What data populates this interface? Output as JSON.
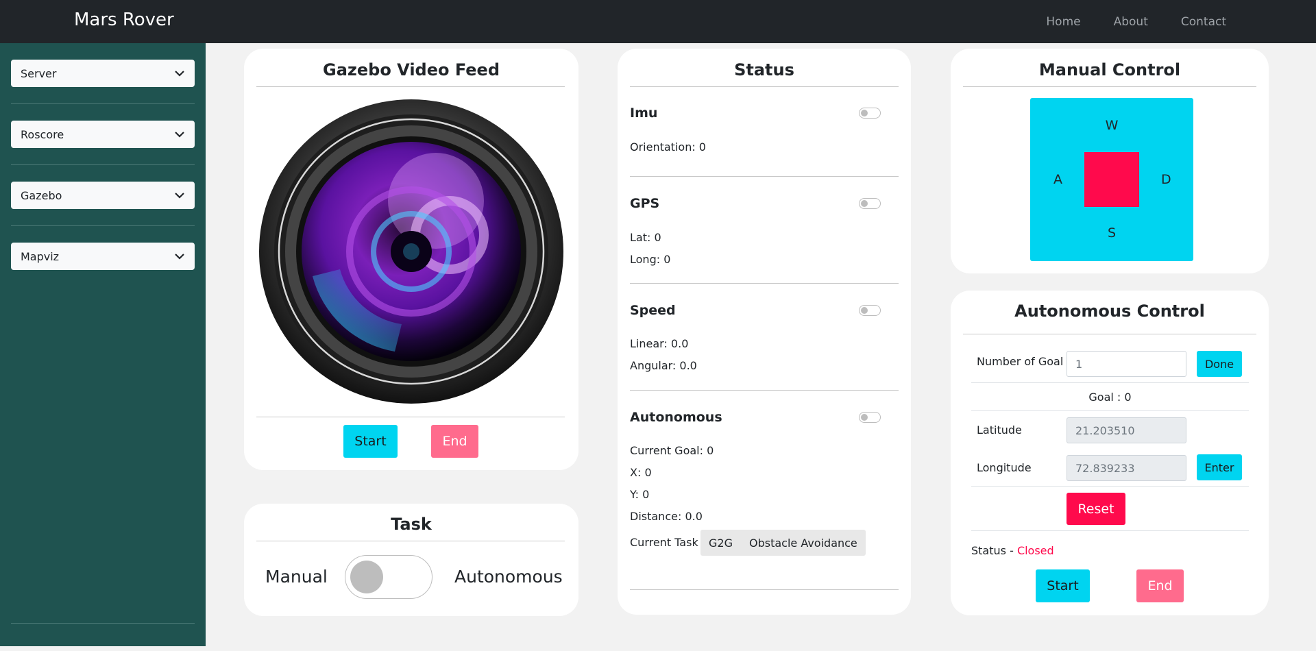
{
  "nav": {
    "brand": "Mars Rover",
    "links": [
      "Home",
      "About",
      "Contact"
    ]
  },
  "sidebar": {
    "selects": [
      "Server",
      "Roscore",
      "Gazebo",
      "Mapviz"
    ]
  },
  "video": {
    "title": "Gazebo Video Feed",
    "start": "Start",
    "end": "End"
  },
  "task": {
    "title": "Task",
    "left": "Manual",
    "right": "Autonomous"
  },
  "status": {
    "title": "Status",
    "imu": {
      "head": "Imu",
      "orientation": "Orientation: 0"
    },
    "gps": {
      "head": "GPS",
      "lat": "Lat: 0",
      "long": "Long: 0"
    },
    "speed": {
      "head": "Speed",
      "linear": "Linear: 0.0",
      "angular": "Angular: 0.0"
    },
    "autonomous": {
      "head": "Autonomous",
      "goal": "Current Goal: 0",
      "x": "X: 0",
      "y": "Y: 0",
      "distance": "Distance: 0.0",
      "task_label": "Current Task :",
      "tasks": [
        "G2G",
        "Obstacle Avoidance"
      ]
    }
  },
  "manual": {
    "title": "Manual Control",
    "w": "W",
    "a": "A",
    "s": "S",
    "d": "D"
  },
  "auto": {
    "title": "Autonomous Control",
    "num_goal_label": "Number of Goal",
    "num_goal_value": "1",
    "done": "Done",
    "goal": "Goal : 0",
    "lat_label": "Latitude",
    "lat_value": "21.203510",
    "long_label": "Longitude",
    "long_value": "72.839233",
    "enter": "Enter",
    "reset": "Reset",
    "status_label": "Status - ",
    "status_value": "Closed",
    "start": "Start",
    "end": "End"
  },
  "colors": {
    "accent": "#00d4f0",
    "danger": "#ff0a4c",
    "sidebar": "#1f5350",
    "navbar": "#212529"
  }
}
